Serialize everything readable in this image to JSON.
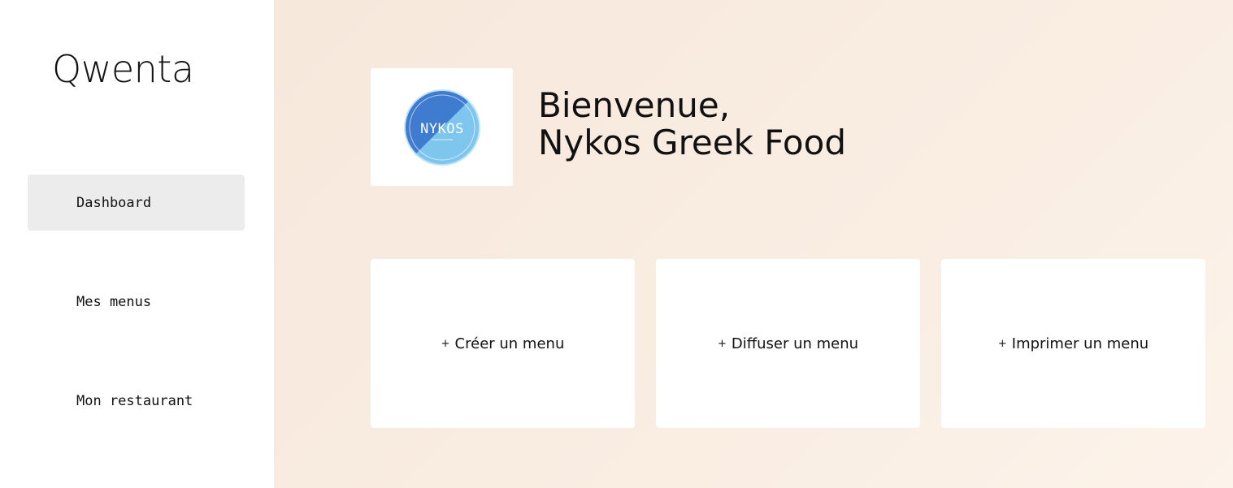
{
  "brand": {
    "name": "Qwenta"
  },
  "sidebar": {
    "items": [
      {
        "label": "Dashboard",
        "active": true
      },
      {
        "label": "Mes menus",
        "active": false
      },
      {
        "label": "Mon restaurant",
        "active": false
      }
    ]
  },
  "header": {
    "greeting": "Bienvenue,",
    "restaurant_name": "Nykos Greek Food",
    "logo_text": "NYKOS"
  },
  "actions": [
    {
      "icon": "+",
      "label": "Créer un menu"
    },
    {
      "icon": "+",
      "label": "Diffuser un menu"
    },
    {
      "icon": "+",
      "label": "Imprimer un menu"
    }
  ],
  "colors": {
    "background_gradient_start": "#f7e8dc",
    "background_gradient_end": "#fcf3ea",
    "sidebar_active": "#ececec",
    "logo_blue_dark": "#3f7ccf",
    "logo_blue_light": "#7fc6ef"
  }
}
